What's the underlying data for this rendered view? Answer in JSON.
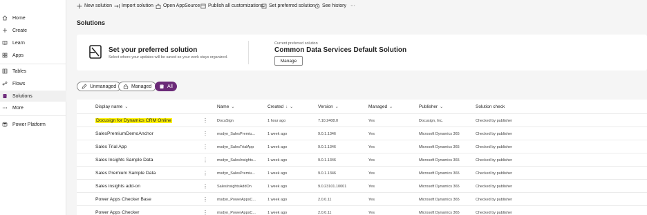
{
  "sidebar": {
    "items": [
      {
        "label": "Home",
        "icon": "home-icon"
      },
      {
        "label": "Create",
        "icon": "plus-icon"
      },
      {
        "label": "Learn",
        "icon": "book-icon"
      },
      {
        "label": "Apps",
        "icon": "apps-icon"
      },
      {
        "label": "Tables",
        "icon": "table-icon"
      },
      {
        "label": "Flows",
        "icon": "flow-icon"
      },
      {
        "label": "Solutions",
        "icon": "solutions-icon"
      },
      {
        "label": "More",
        "icon": "ellipsis-icon"
      },
      {
        "label": "Power Platform",
        "icon": "power-platform-icon"
      }
    ]
  },
  "toolbar": {
    "new_solution": "New solution",
    "import_solution": "Import solution",
    "open_appsource": "Open AppSource",
    "publish_all": "Publish all customizations",
    "set_preferred": "Set preferred solution",
    "see_history": "See history",
    "more": "···"
  },
  "page": {
    "title": "Solutions"
  },
  "preferred": {
    "title": "Set your preferred solution",
    "subtitle": "Select where your updates will be saved so your work stays organized.",
    "current_label": "Current preferred solution",
    "current_value": "Common Data Services Default Solution",
    "manage_label": "Manage"
  },
  "filters": {
    "unmanaged": "Unmanaged",
    "managed": "Managed",
    "all": "All"
  },
  "table": {
    "columns": {
      "display_name": "Display name",
      "name": "Name",
      "created": "Created",
      "version": "Version",
      "managed": "Managed",
      "publisher": "Publisher",
      "solution_check": "Solution check"
    },
    "sort_indicator": "↓",
    "rows": [
      {
        "display": "Docusign for Dynamics CRM Online",
        "name": "DocuSign",
        "created": "1 hour ago",
        "version": "7.10.2408.0",
        "managed": "Yes",
        "publisher": "Docusign, Inc.",
        "check": "Checked by publisher"
      },
      {
        "display": "SalesPremiumDemoAnchor",
        "name": "msdyn_SalesPremiu...",
        "created": "1 week ago",
        "version": "9.0.1.1346",
        "managed": "Yes",
        "publisher": "Microsoft Dynamics 365",
        "check": "Checked by publisher"
      },
      {
        "display": "Sales Trial App",
        "name": "msdyn_SalesTrialApp",
        "created": "1 week ago",
        "version": "9.0.1.1346",
        "managed": "Yes",
        "publisher": "Microsoft Dynamics 365",
        "check": "Checked by publisher"
      },
      {
        "display": "Sales Insights Sample Data",
        "name": "msdyn_SalesInsights...",
        "created": "1 week ago",
        "version": "9.0.1.1346",
        "managed": "Yes",
        "publisher": "Microsoft Dynamics 365",
        "check": "Checked by publisher"
      },
      {
        "display": "Sales Premium Sample Data",
        "name": "msdyn_SalesPremiu...",
        "created": "1 week ago",
        "version": "9.0.1.1346",
        "managed": "Yes",
        "publisher": "Microsoft Dynamics 365",
        "check": "Checked by publisher"
      },
      {
        "display": "Sales insights add-on",
        "name": "SalesInsightsAddOn",
        "created": "1 week ago",
        "version": "9.0.23101.10001",
        "managed": "Yes",
        "publisher": "Microsoft Dynamics 365",
        "check": "Checked by publisher"
      },
      {
        "display": "Power Apps Checker Base",
        "name": "msdyn_PowerAppsC...",
        "created": "1 week ago",
        "version": "2.0.0.11",
        "managed": "Yes",
        "publisher": "Microsoft Dynamics 365",
        "check": "Checked by publisher"
      },
      {
        "display": "Power Apps Checker",
        "name": "msdyn_PowerAppsC...",
        "created": "1 week ago",
        "version": "2.0.0.11",
        "managed": "Yes",
        "publisher": "Microsoft Dynamics 365",
        "check": "Checked by publisher"
      }
    ]
  },
  "colors": {
    "accent": "#6b2a78",
    "highlight": "#fff200"
  }
}
